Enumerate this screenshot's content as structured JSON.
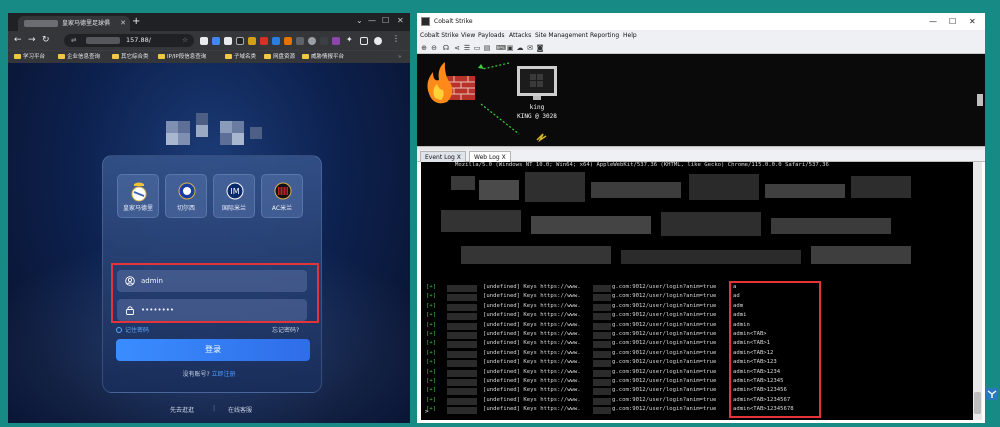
{
  "browser": {
    "tab_title": "皇家马德里足球俱",
    "url_fragment": "157.88/",
    "bookmarks": [
      "学习平台",
      "企业信息查询",
      "其它综合类",
      "IP/IP段信息查询",
      "子域名类",
      "网盘资源",
      "威胁情报平台"
    ],
    "login": {
      "clubs": [
        "皇家马德里",
        "切尔西",
        "国际米兰",
        "AC米兰"
      ],
      "username": "admin",
      "password": "••••••••",
      "remember_label": "记住密码",
      "forgot_label": "忘记密码?",
      "login_button": "登录",
      "no_account_text": "没有账号?",
      "register_link": "立即注册",
      "footer_left": "先去逛逛",
      "footer_right": "在线客服"
    }
  },
  "cobalt": {
    "window_title": "Cobalt Strike",
    "menu": [
      "Cobalt Strike",
      "View",
      "Payloads",
      "Attacks",
      "Site Management",
      "Reporting",
      "Help"
    ],
    "graph": {
      "host_name": "king",
      "host_label": "KING @ 3028"
    },
    "tabs": [
      {
        "label": "Event Log",
        "close": "X"
      },
      {
        "label": "Web Log",
        "close": "X"
      }
    ],
    "user_agent_line": "Mozilla/5.0 (Windows NT 10.0; Win64; x64) AppleWebKit/537.36 (KHTML, like Gecko) Chrome/115.0.0.0 Safari/537.36",
    "log_prefix": "[+]",
    "log_message": "[undefined] Keys https://www.",
    "log_url_tail": "g.com:9012/user/login?anim=true",
    "keys": [
      "a",
      "ad",
      "adm",
      "admi",
      "admin",
      "admin<TAB>",
      "admin<TAB>1",
      "admin<TAB>12",
      "admin<TAB>123",
      "admin<TAB>1234",
      "admin<TAB>12345",
      "admin<TAB>123456",
      "admin<TAB>1234567",
      "admin<TAB>12345678"
    ],
    "prompt": ">"
  },
  "colors": {
    "desktop": "#178a86",
    "highlight_box": "#e3343a",
    "login_button": "#2f6de8"
  }
}
